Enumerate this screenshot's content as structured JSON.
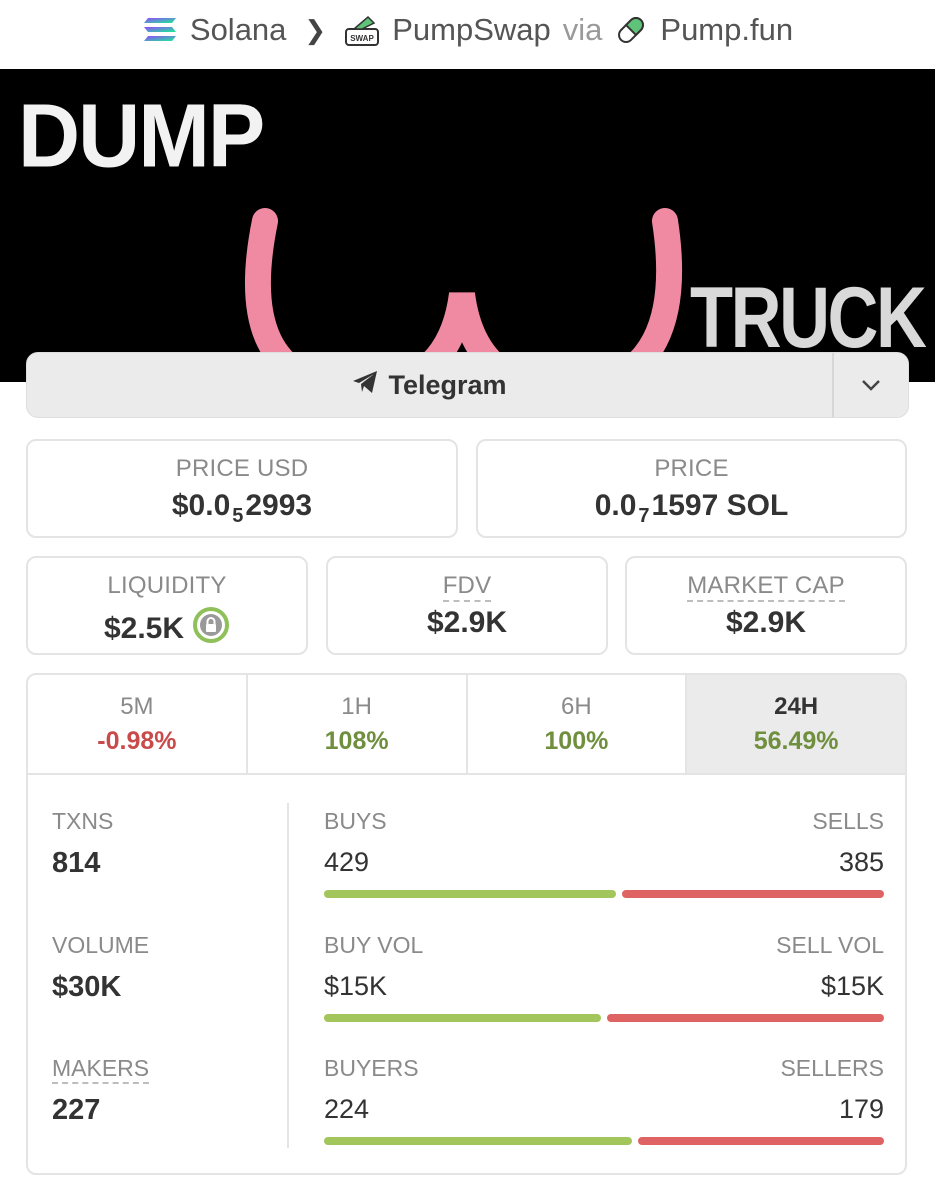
{
  "breadcrumb": {
    "chain": "Solana",
    "dex": "PumpSwap",
    "via": "via",
    "source": "Pump.fun"
  },
  "banner": {
    "text_top": "DUMP",
    "text_bottom": "TRUCK"
  },
  "telegram": {
    "label": "Telegram"
  },
  "price_usd": {
    "label": "PRICE USD",
    "prefix": "$0.0",
    "subscript": "5",
    "suffix": "2993"
  },
  "price_sol": {
    "label": "PRICE",
    "prefix": "0.0",
    "subscript": "7",
    "suffix": "1597 SOL"
  },
  "liquidity": {
    "label": "LIQUIDITY",
    "value": "$2.5K"
  },
  "fdv": {
    "label": "FDV",
    "value": "$2.9K"
  },
  "market_cap": {
    "label": "MARKET CAP",
    "value": "$2.9K"
  },
  "timeframes": [
    {
      "label": "5M",
      "change": "-0.98%"
    },
    {
      "label": "1H",
      "change": "108%"
    },
    {
      "label": "6H",
      "change": "100%"
    },
    {
      "label": "24H",
      "change": "56.49%"
    }
  ],
  "stats": {
    "txns": {
      "label": "TXNS",
      "value": "814"
    },
    "volume": {
      "label": "VOLUME",
      "value": "$30K"
    },
    "makers": {
      "label": "MAKERS",
      "value": "227"
    }
  },
  "splits": {
    "txns": {
      "left_label": "BUYS",
      "right_label": "SELLS",
      "left_value": "429",
      "right_value": "385",
      "buy_fraction": 0.527
    },
    "volume": {
      "left_label": "BUY VOL",
      "right_label": "SELL VOL",
      "left_value": "$15K",
      "right_value": "$15K",
      "buy_fraction": 0.5
    },
    "makers": {
      "left_label": "BUYERS",
      "right_label": "SELLERS",
      "left_value": "224",
      "right_value": "179",
      "buy_fraction": 0.556
    }
  },
  "colors": {
    "positive": "#6f8f3e",
    "negative": "#c94a4a",
    "buy_bar": "#a2c65c",
    "sell_bar": "#e06363",
    "banner_pink": "#f08aa3"
  }
}
